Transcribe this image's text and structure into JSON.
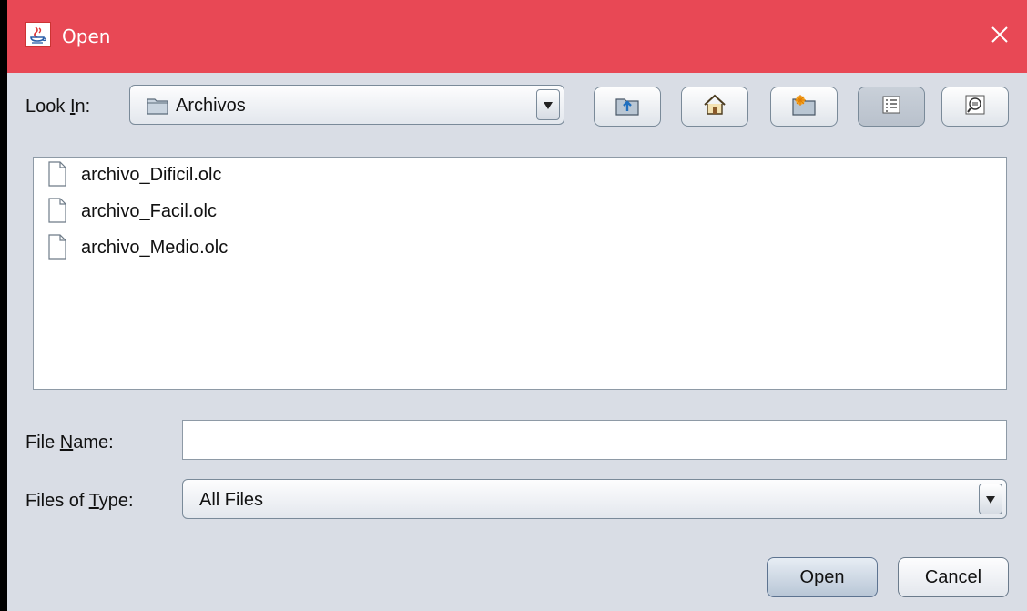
{
  "window": {
    "title": "Open",
    "close_glyph": "✕"
  },
  "look_in": {
    "label_prefix": "Look ",
    "label_mnemonic": "I",
    "label_suffix": "n:",
    "selected": "Archivos",
    "icon": "folder-icon"
  },
  "toolbar": {
    "buttons": [
      {
        "name": "up-one-level-button",
        "icon": "folder-up-icon"
      },
      {
        "name": "home-button",
        "icon": "home-icon"
      },
      {
        "name": "new-folder-button",
        "icon": "new-folder-icon"
      },
      {
        "name": "list-view-button",
        "icon": "list-view-icon",
        "active": true
      },
      {
        "name": "details-view-button",
        "icon": "details-view-icon"
      }
    ]
  },
  "files": [
    {
      "name": "archivo_Dificil.olc",
      "icon": "file-icon"
    },
    {
      "name": "archivo_Facil.olc",
      "icon": "file-icon"
    },
    {
      "name": "archivo_Medio.olc",
      "icon": "file-icon"
    }
  ],
  "file_name": {
    "label_prefix": "File ",
    "label_mnemonic": "N",
    "label_suffix": "ame:",
    "value": ""
  },
  "file_type": {
    "label_prefix": "Files of ",
    "label_mnemonic": "T",
    "label_suffix": "ype:",
    "selected": "All Files"
  },
  "actions": {
    "open_label": "Open",
    "cancel_label": "Cancel"
  },
  "colors": {
    "titlebar": "#e84855",
    "dialog_bg": "#d9dde5",
    "list_bg": "#ffffff"
  }
}
